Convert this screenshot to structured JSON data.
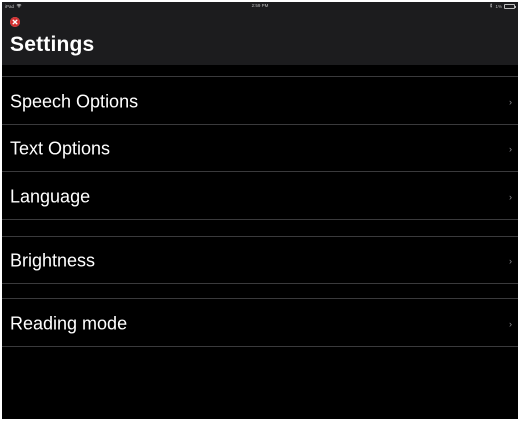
{
  "status_bar": {
    "device": "iPad",
    "time": "2:59 PM",
    "battery_percent": "1%"
  },
  "header": {
    "title": "Settings"
  },
  "settings_items": [
    {
      "label": "Speech Options"
    },
    {
      "label": "Text Options"
    },
    {
      "label": "Language"
    },
    {
      "label": "Brightness"
    },
    {
      "label": "Reading mode"
    }
  ],
  "icons": {
    "close": "close-icon",
    "chevron": "chevron-right-icon",
    "wifi": "wifi-icon",
    "bluetooth": "bluetooth-icon",
    "battery": "battery-icon"
  },
  "colors": {
    "background": "#000000",
    "header": "#1c1c1e",
    "separator": "#3a3a3c",
    "close_button": "#d32f2f",
    "text": "#ffffff",
    "chevron": "#8e8e93"
  }
}
